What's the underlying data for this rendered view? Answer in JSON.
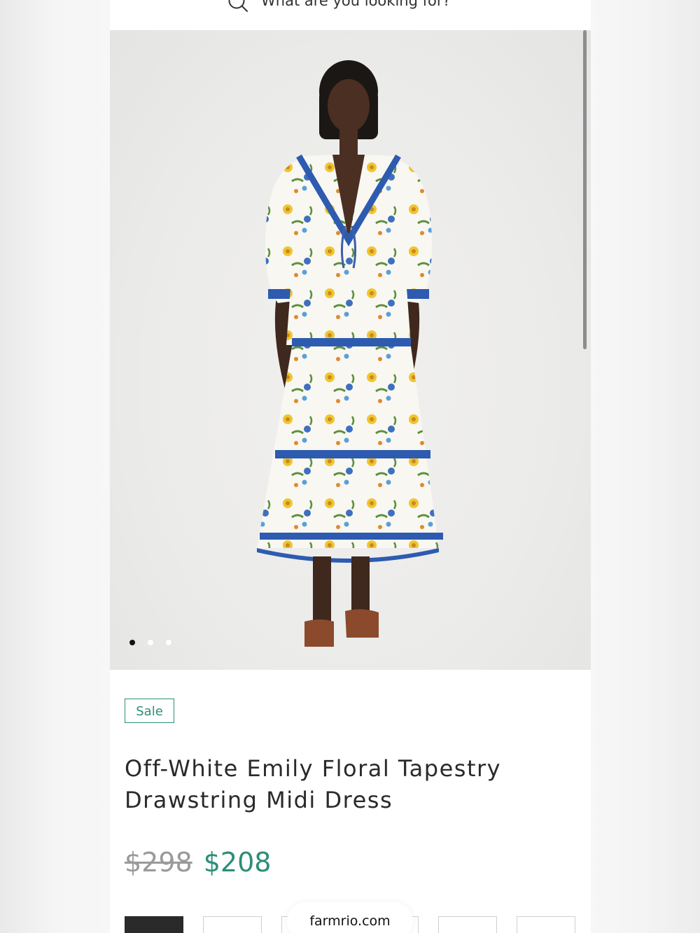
{
  "search": {
    "placeholder": "What are you looking for?",
    "icon": "search-icon"
  },
  "product_image": {
    "alt": "Off-White Emily Floral Tapestry Drawstring Midi Dress",
    "carousel_dots": 3,
    "active_index": 0
  },
  "product": {
    "badge": "Sale",
    "title": "Off-White Emily Floral Tapestry Drawstring Midi Dress",
    "price_original": "$298",
    "price_sale": "$208"
  },
  "browser": {
    "url": "farmrio.com"
  },
  "colors": {
    "accent_green": "#2c8e78",
    "text_dark": "#2a2a2a",
    "price_strike": "#9a9a9a"
  }
}
